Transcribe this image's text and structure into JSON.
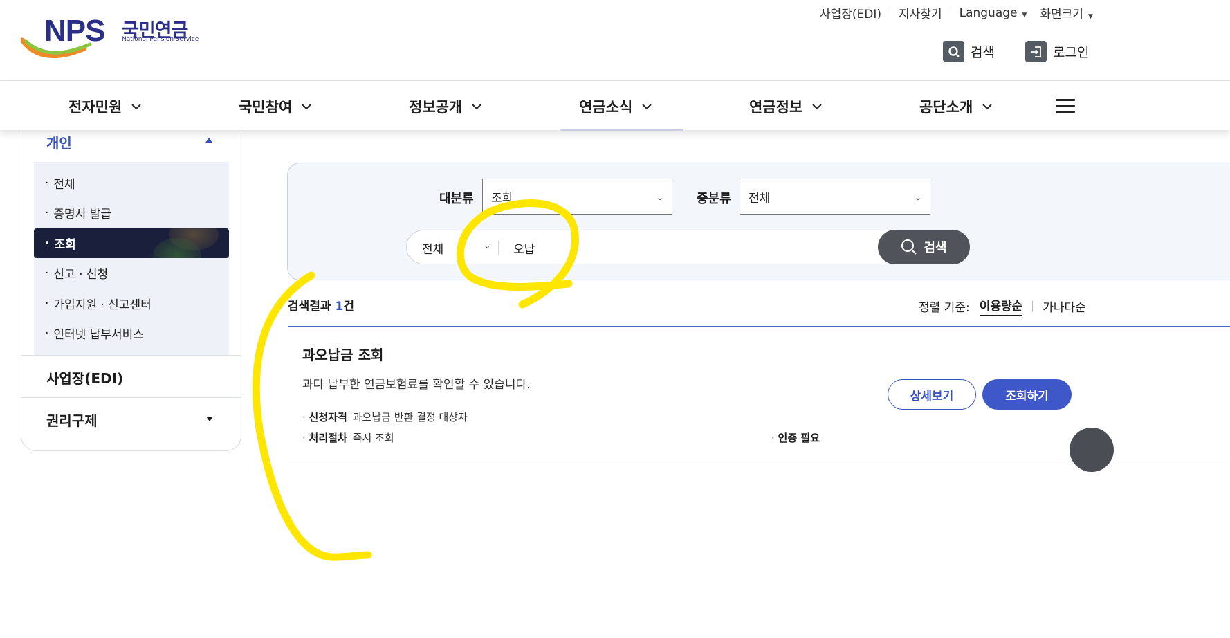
{
  "header": {
    "logo": {
      "abbr": "NPS",
      "name_kr": "국민연금",
      "name_en": "National Pension Service"
    },
    "utility": [
      "사업장(EDI)",
      "지사찾기",
      "Language",
      "화면크기"
    ],
    "search_label": "검색",
    "login_label": "로그인"
  },
  "gnb": [
    "전자민원",
    "국민참여",
    "정보공개",
    "연금소식",
    "연금정보",
    "공단소개"
  ],
  "sidebar": {
    "section_personal": "개인",
    "items": [
      "전체",
      "증명서 발급",
      "조회",
      "신고 · 신청",
      "가입지원 · 신고센터",
      "인터넷 납부서비스"
    ],
    "active_index": 2,
    "section_edi": "사업장(EDI)",
    "section_rights": "권리구제"
  },
  "search": {
    "major_label": "대분류",
    "major_value": "조회",
    "minor_label": "중분류",
    "minor_value": "전체",
    "scope": "전체",
    "query": "오납",
    "button": "검색"
  },
  "results": {
    "count_prefix": "검색결과 ",
    "count": "1",
    "count_suffix": "건",
    "sort_label": "정렬 기준:",
    "sort_options": [
      "이용량순",
      "가나다순"
    ],
    "items": [
      {
        "title": "과오납금 조회",
        "desc": "과다 납부한 연금보험료를 확인할 수 있습니다.",
        "eligibility_label": "신청자격",
        "eligibility": "과오납금 반환 결정 대상자",
        "process_label": "처리절차",
        "process": "즉시 조회",
        "auth": "인증 필요",
        "detail_button": "상세보기",
        "inquiry_button": "조회하기"
      }
    ]
  },
  "colors": {
    "primary": "#3f58c9",
    "navy": "#1a1f3c",
    "annotation": "#ffe600"
  }
}
